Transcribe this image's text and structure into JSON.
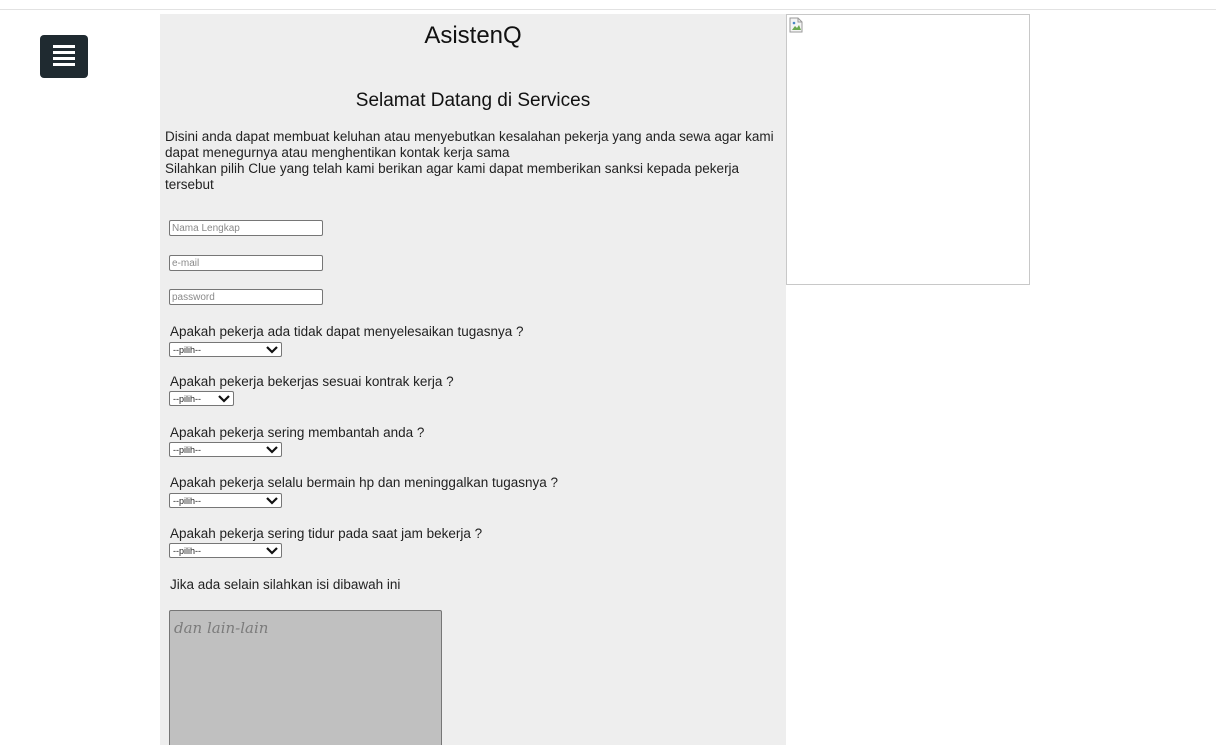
{
  "header": {
    "brand": "AsistenQ",
    "menu_icon": "hamburger-menu-icon"
  },
  "main": {
    "welcome": "Selamat Datang di Services",
    "intro_lines": [
      "Disini anda dapat membuat keluhan atau menyebutkan kesalahan pekerja yang anda sewa agar kami dapat menegurnya atau menghentikan kontak kerja sama",
      "Silahkan pilih Clue yang telah kami berikan agar kami dapat memberikan sanksi kepada pekerja tersebut"
    ]
  },
  "form": {
    "name_placeholder": "Nama Lengkap",
    "email_placeholder": "e-mail",
    "password_placeholder": "password",
    "questions": [
      {
        "label": "Apakah pekerja ada tidak dapat menyelesaikan tugasnya ?",
        "selected": "--pilih--"
      },
      {
        "label": "Apakah pekerja bekerjas sesuai kontrak kerja ?",
        "selected": "--pilih--"
      },
      {
        "label": "Apakah pekerja sering membantah anda ?",
        "selected": "--pilih--"
      },
      {
        "label": "Apakah pekerja selalu bermain hp dan meninggalkan tugasnya ?",
        "selected": "--pilih--"
      },
      {
        "label": "Apakah pekerja sering tidur pada saat jam bekerja ?",
        "selected": "--pilih--"
      }
    ],
    "other_label": "Jika ada selain silahkan isi dibawah ini",
    "other_placeholder": "dan lain-lain"
  },
  "side_image": {
    "icon": "broken-image-icon"
  },
  "colors": {
    "panel_bg": "#eeeeee",
    "menu_button_bg": "#1f2a30",
    "textarea_bg": "#c0c0c0"
  }
}
